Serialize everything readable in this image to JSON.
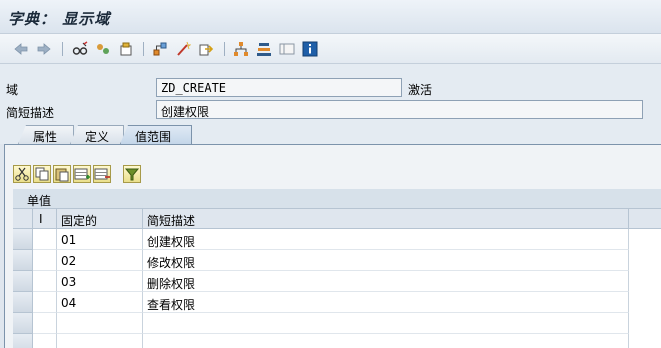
{
  "window": {
    "title": "字典： 显示域"
  },
  "toolbar": {
    "icons": [
      "back-icon",
      "forward-icon",
      "glasses-icon",
      "switch-icon",
      "object-icon",
      "hierarchy-icon",
      "wand-icon",
      "export-icon",
      "tree-icon",
      "stack-icon",
      "layout-icon",
      "info-icon"
    ]
  },
  "form": {
    "domain_label": "域",
    "domain_value": "ZD_CREATE",
    "status": "激活",
    "short_desc_label": "简短描述",
    "short_desc_value": "创建权限"
  },
  "tabs": [
    {
      "label": "属性",
      "active": false
    },
    {
      "label": "定义",
      "active": false
    },
    {
      "label": "值范围",
      "active": true
    }
  ],
  "value_range": {
    "section_title": "单值",
    "columns": [
      "I",
      "固定的",
      "简短描述"
    ],
    "rows": [
      {
        "fixed": "01",
        "desc": "创建权限"
      },
      {
        "fixed": "02",
        "desc": "修改权限"
      },
      {
        "fixed": "03",
        "desc": "删除权限"
      },
      {
        "fixed": "04",
        "desc": "查看权限"
      },
      {
        "fixed": "",
        "desc": ""
      },
      {
        "fixed": "",
        "desc": ""
      }
    ]
  },
  "colors": {
    "accent": "#7c93ab",
    "button_fill": "#eadf8c"
  }
}
